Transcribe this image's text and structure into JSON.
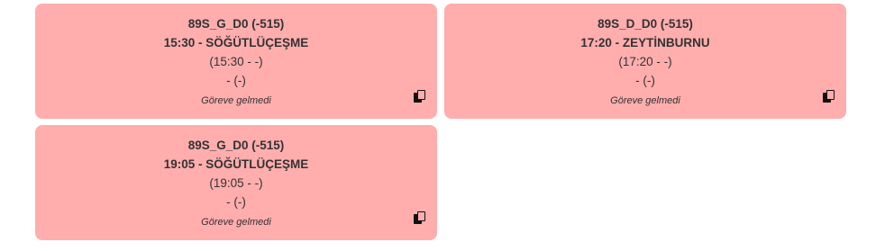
{
  "cards": [
    {
      "route": "89S_G_D0 (-515)",
      "departure": "15:30 - SÖĞÜTLÜÇEŞME",
      "times": "(15:30 - -)",
      "extra": "- (-)",
      "status": "Göreve gelmedi",
      "icon": "copy-icon"
    },
    {
      "route": "89S_D_D0 (-515)",
      "departure": "17:20 - ZEYTİNBURNU",
      "times": "(17:20 - -)",
      "extra": "- (-)",
      "status": "Göreve gelmedi",
      "icon": "copy-icon"
    },
    {
      "route": "89S_G_D0 (-515)",
      "departure": "19:05 - SÖĞÜTLÜÇEŞME",
      "times": "(19:05 - -)",
      "extra": "- (-)",
      "status": "Göreve gelmedi",
      "icon": "copy-icon"
    }
  ],
  "colors": {
    "card_background": "#ffadad",
    "text": "#333333",
    "icon": "#111111"
  }
}
